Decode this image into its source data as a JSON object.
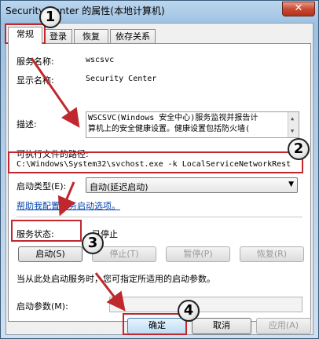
{
  "window": {
    "title": "Security Center 的属性(本地计算机)",
    "close_glyph": "✕"
  },
  "tabs": [
    {
      "label": "常规"
    },
    {
      "label": "登录"
    },
    {
      "label": "恢复"
    },
    {
      "label": "依存关系"
    }
  ],
  "general": {
    "service_name_label": "服务名称:",
    "service_name": "wscsvc",
    "display_name_label": "显示名称:",
    "display_name": "Security Center",
    "description_label": "描述:",
    "description_line1": "WSCSVC(Windows 安全中心)服务监视并报告计",
    "description_line2": "算机上的安全健康设置。健康设置包括防火墙(",
    "exe_path_label": "可执行文件的路径:",
    "exe_path": "C:\\Windows\\System32\\svchost.exe -k LocalServiceNetworkRest",
    "startup_type_label": "启动类型(E):",
    "startup_type_value": "自动(延迟启动)",
    "help_link": "帮助我配置服务启动选项。",
    "service_status_label": "服务状态:",
    "service_status": "已停止",
    "start_button": "启动(S)",
    "stop_button": "停止(T)",
    "pause_button": "暂停(P)",
    "resume_button": "恢复(R)",
    "start_hint": "当从此处启动服务时，您可指定所适用的启动参数。",
    "start_params_label": "启动参数(M):",
    "start_params_value": ""
  },
  "footer": {
    "ok_button": "确定",
    "cancel_button": "取消",
    "apply_button": "应用(A)"
  },
  "annotations": {
    "markers": [
      "1",
      "2",
      "3",
      "4"
    ],
    "highlight_color": "#c0282d"
  }
}
